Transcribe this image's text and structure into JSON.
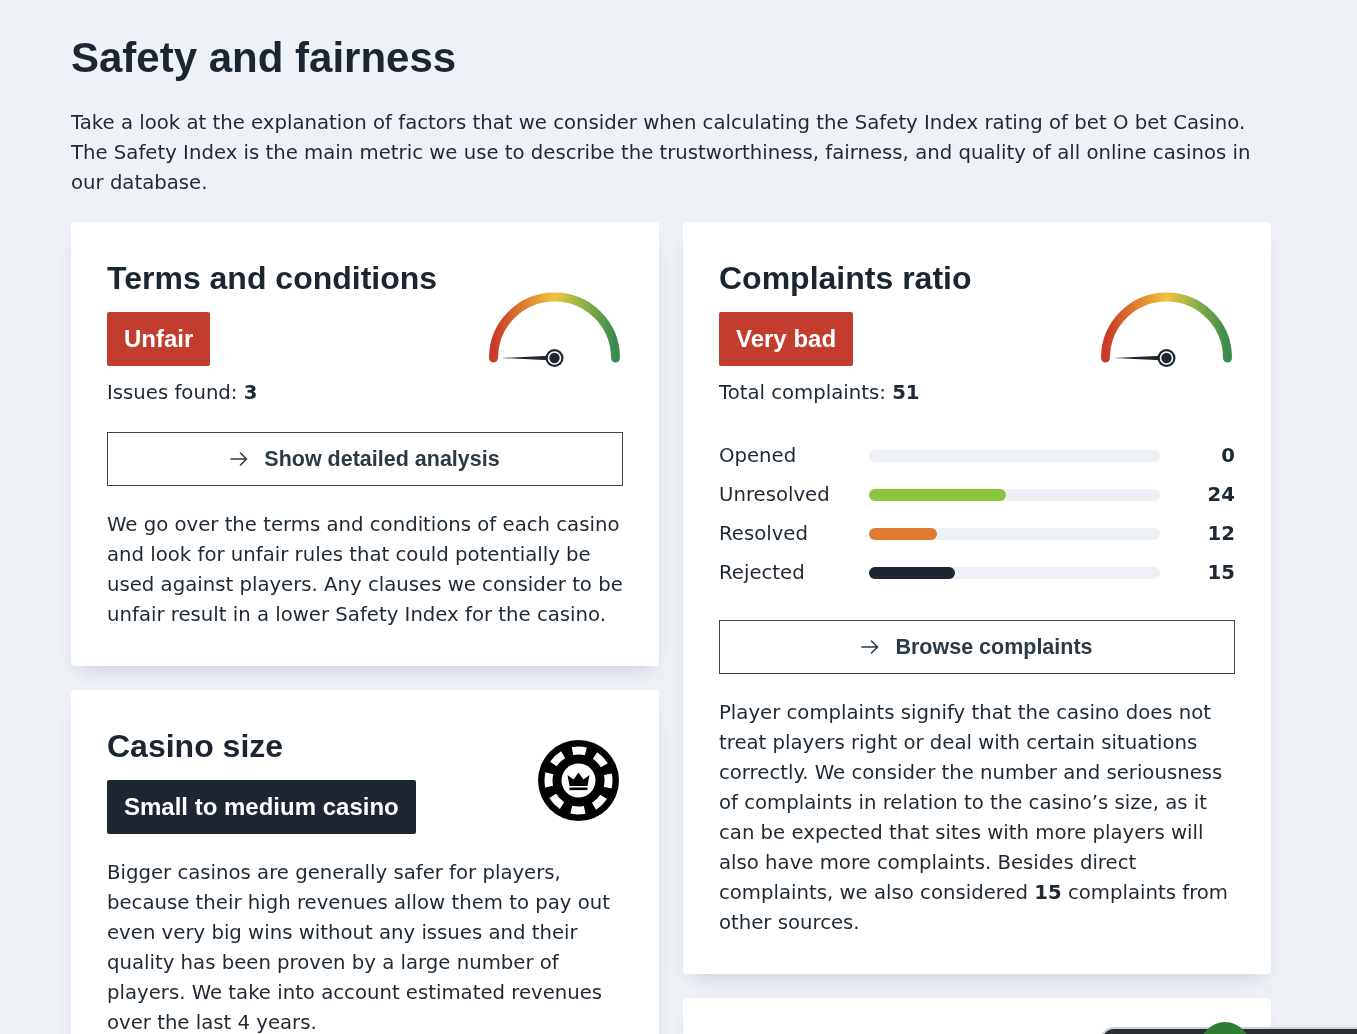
{
  "header": {
    "title": "Safety and fairness",
    "intro": "Take a look at the explanation of factors that we consider when calculating the Safety Index rating of bet O bet Casino. The Safety Index is the main metric we use to describe the trustworthiness, fairness, and quality of all online casinos in our database."
  },
  "columns": [
    {
      "cards": [
        {
          "kind": "rating",
          "title": "Terms and conditions",
          "badge": {
            "text": "Unfair",
            "color": "#c33d2e"
          },
          "indicator": {
            "kind": "gauge"
          },
          "summary": "Issues found: **3**",
          "button": "Show detailed analysis",
          "description": "We go over the terms and conditions of each casino and look for unfair rules that could potentially be used against players. Any clauses we consider to be unfair result in a lower Safety Index for the casino."
        },
        {
          "kind": "rating",
          "title": "Casino size",
          "badge": {
            "text": "Small to medium casino",
            "color": "#1e2731"
          },
          "indicator": {
            "kind": "chip"
          },
          "description": "Bigger casinos are generally safer for players, because their high revenues allow them to pay out even very big wins without any issues and their quality has been proven by a large number of players. We take into account estimated revenues over the last 4 years."
        }
      ]
    },
    {
      "cards": [
        {
          "kind": "rating",
          "title": "Complaints ratio",
          "badge": {
            "text": "Very bad",
            "color": "#c33d2e"
          },
          "indicator": {
            "kind": "gauge"
          },
          "summary": "Total complaints: **51**",
          "stats": [
            {
              "label": "Opened",
              "value": "0"
            },
            {
              "label": "Unresolved",
              "value": "24",
              "level": 0.47,
              "color": "#8cc63f"
            },
            {
              "label": "Resolved",
              "value": "12",
              "level": 0.235,
              "color": "#e07a2e"
            },
            {
              "label": "Rejected",
              "value": "15",
              "level": 0.294,
              "color": "#1e2731"
            }
          ],
          "button": "Browse complaints",
          "description": "Player complaints signify that the casino does not treat players right or deal with certain situations correctly. We consider the number and seriousness of complaints in relation to the casino’s size, as it can be expected that sites with more players will also have more complaints. Besides direct complaints, we also considered **15** complaints from other sources."
        },
        {
          "kind": "blank"
        }
      ]
    }
  ]
}
